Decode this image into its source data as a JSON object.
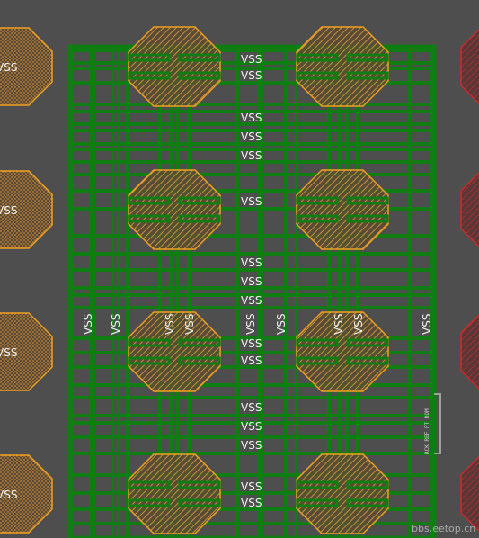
{
  "canvas": {
    "background": "#4e4e4e",
    "net_name": "VSS"
  },
  "colors": {
    "route_green": "#0f7d12",
    "route_green_dark": "#0b5f0d",
    "pad_orange": "#f0a020",
    "pad_fill": "#a07036",
    "pad_red": "#cc2a2a",
    "label": "#f2f2f2"
  },
  "left_pad_labels": [
    "VSS",
    "VSS",
    "VSS",
    "VSS"
  ],
  "right_pad_labels": [
    "",
    "",
    "",
    ""
  ],
  "vertical_labels": [
    "VSS",
    "VSS",
    "VSS",
    "VSS",
    "VSS",
    "VSS",
    "VSS",
    "VSS",
    "VSS"
  ],
  "row_labels": [
    "VSS",
    "VSS",
    "VSS",
    "VSS",
    "VSS",
    "VSS",
    "VSS",
    "VSS",
    "VSS",
    "VSS",
    "VSS",
    "VSS",
    "VSS",
    "VSS",
    "VSS",
    "VSS"
  ],
  "marker_text": "RCK_REF_PT_ROM",
  "watermark": "bbs.eetop.cn"
}
